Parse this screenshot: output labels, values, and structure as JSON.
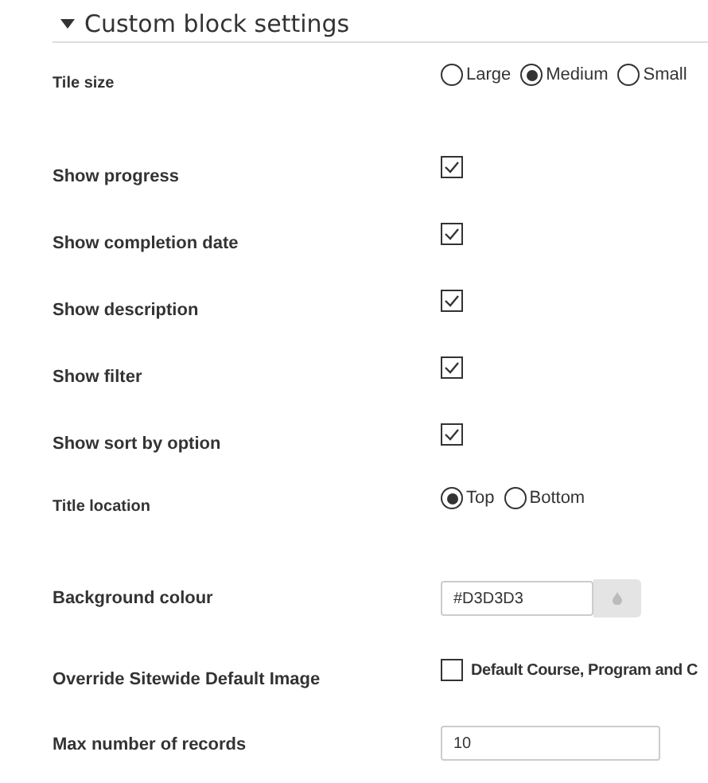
{
  "section": {
    "title": "Custom block settings",
    "expanded": true
  },
  "settings": [
    {
      "kind": "radio",
      "label": "Tile size",
      "options": [
        {
          "label": "Large",
          "selected": false
        },
        {
          "label": "Medium",
          "selected": true
        },
        {
          "label": "Small",
          "selected": false
        }
      ]
    },
    {
      "kind": "checkbox",
      "label": "Show progress",
      "checked": true
    },
    {
      "kind": "checkbox",
      "label": "Show completion date",
      "checked": true
    },
    {
      "kind": "checkbox",
      "label": "Show description",
      "checked": true
    },
    {
      "kind": "checkbox",
      "label": "Show filter",
      "checked": true
    },
    {
      "kind": "checkbox",
      "label": "Show sort by option",
      "checked": true
    },
    {
      "kind": "radio",
      "label": "Title location",
      "options": [
        {
          "label": "Top",
          "selected": true
        },
        {
          "label": "Bottom",
          "selected": false
        }
      ]
    },
    {
      "kind": "color",
      "label": "Background colour",
      "value": "#D3D3D3"
    },
    {
      "kind": "checkbox",
      "label": "Override Sitewide Default Image",
      "checked": false,
      "option_label": "Default Course, Program and C"
    },
    {
      "kind": "number",
      "label": "Max number of records",
      "value": "10"
    }
  ]
}
